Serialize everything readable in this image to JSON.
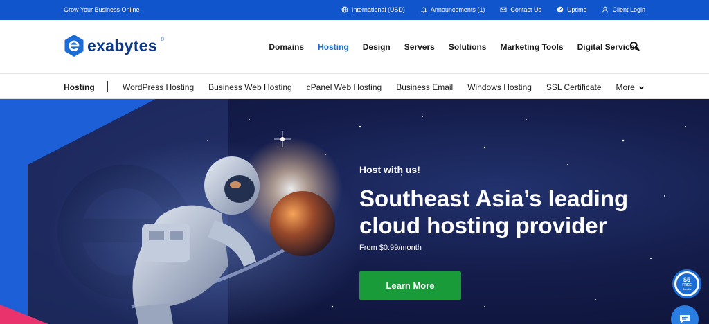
{
  "topbar": {
    "tagline": "Grow Your Business Online",
    "links": [
      {
        "label": "International (USD)",
        "icon": "globe-icon"
      },
      {
        "label": "Announcements (1)",
        "icon": "bell-icon"
      },
      {
        "label": "Contact Us",
        "icon": "mail-icon"
      },
      {
        "label": "Uptime",
        "icon": "gauge-icon"
      },
      {
        "label": "Client Login",
        "icon": "user-icon"
      }
    ]
  },
  "brand": {
    "name": "exabytes",
    "reg_mark": "®"
  },
  "nav": {
    "items": [
      "Domains",
      "Hosting",
      "Design",
      "Servers",
      "Solutions",
      "Marketing Tools",
      "Digital Services"
    ],
    "active": "Hosting"
  },
  "subnav": {
    "title": "Hosting",
    "items": [
      "WordPress Hosting",
      "Business Web Hosting",
      "cPanel Web Hosting",
      "Business Email",
      "Windows Hosting",
      "SSL Certificate"
    ],
    "more_label": "More"
  },
  "hero": {
    "eyebrow": "Host with us!",
    "title_line1": "Southeast Asia’s leading",
    "title_line2": "cloud hosting provider",
    "price": "From $0.99/month",
    "cta": "Learn More"
  },
  "badge": {
    "amount": "$5",
    "line1": "FREE",
    "line2": "Credits"
  },
  "colors": {
    "topbar": "#1155cc",
    "brand": "#0b3a8c",
    "active_nav": "#1d6dd6",
    "cta": "#1a9b3a",
    "hero_bg": "#141c4a"
  }
}
